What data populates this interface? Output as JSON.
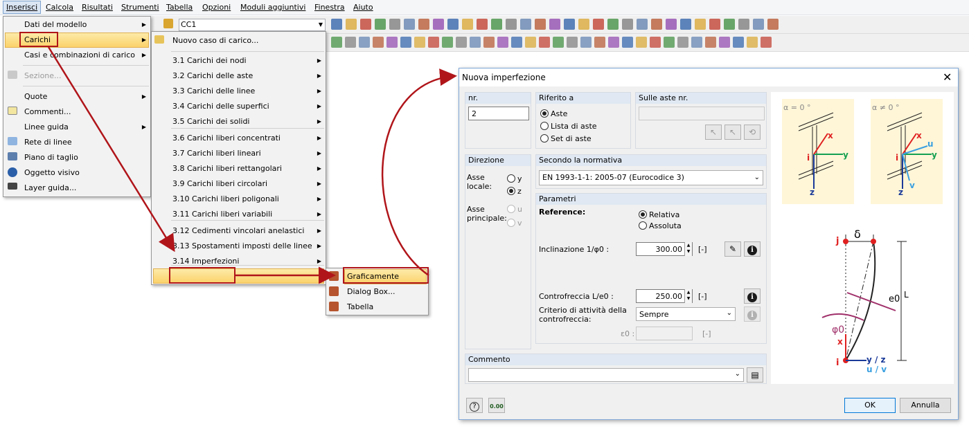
{
  "menubar": {
    "items": [
      "Inserisci",
      "Calcola",
      "Risultati",
      "Strumenti",
      "Tabella",
      "Opzioni",
      "Moduli aggiuntivi",
      "Finestra",
      "Aiuto"
    ]
  },
  "toolbar": {
    "loadcase": "CC1"
  },
  "menu1": {
    "items": [
      "Dati del modello",
      "Carichi",
      "Casi e combinazioni di carico",
      "Sezione...",
      "Quote",
      "Commenti...",
      "Linee guida",
      "Rete di linee",
      "Piano di taglio",
      "Oggetto visivo",
      "Layer guida..."
    ]
  },
  "menu2": {
    "items": [
      "Nuovo caso di carico...",
      "3.1 Carichi dei nodi",
      "3.2 Carichi delle aste",
      "3.3 Carichi delle linee",
      "3.4 Carichi delle superfici",
      "3.5 Carichi dei solidi",
      "3.6 Carichi liberi concentrati",
      "3.7 Carichi liberi lineari",
      "3.8 Carichi liberi rettangolari",
      "3.9 Carichi liberi circolari",
      "3.10 Carichi liberi poligonali",
      "3.11 Carichi liberi variabili",
      "3.12 Cedimenti vincolari anelastici",
      "3.13 Spostamenti imposti delle linee",
      "3.14 Imperfezioni"
    ]
  },
  "menu3": {
    "items": [
      "Graficamente",
      "Dialog Box...",
      "Tabella"
    ]
  },
  "dialog": {
    "title": "Nuova imperfezione",
    "nr_label": "nr.",
    "nr_value": "2",
    "riferimento": {
      "label": "Riferito a",
      "options": [
        "Aste",
        "Lista di aste",
        "Set di aste"
      ]
    },
    "sulle_aste": {
      "label": "Sulle aste nr."
    },
    "direzione": {
      "label": "Direzione",
      "asse_locale": "Asse locale:",
      "asse_principale": "Asse principale:",
      "opts_local": [
        "y",
        "z"
      ],
      "opts_principal": [
        "u",
        "v"
      ]
    },
    "normativa": {
      "label": "Secondo la normativa",
      "value": "EN 1993-1-1: 2005-07  (Eurocodice 3)"
    },
    "parametri": {
      "label": "Parametri",
      "reference": "Reference:",
      "ref_opts": [
        "Relativa",
        "Assoluta"
      ],
      "inclinazione_label": "Inclinazione 1/φ0 :",
      "inclinazione_value": "300.00",
      "unit": "[-]",
      "controfreccia_label": "Controfreccia L/e0 :",
      "controfreccia_value": "250.00",
      "criterio_label": "Criterio di attività della controfreccia:",
      "criterio_value": "Sempre",
      "e0_label": "ε0 :"
    },
    "commento": {
      "label": "Commento"
    },
    "buttons": {
      "ok": "OK",
      "cancel": "Annulla"
    },
    "diagram": {
      "alpha0": "α = 0 °",
      "alphaN": "α ≠ 0 °",
      "delta": "δ",
      "e0": "e0",
      "phi0": "φ0",
      "L": "L",
      "j": "j",
      "i": "i",
      "x": "x",
      "y": "y",
      "z": "z",
      "u": "u",
      "v": "v",
      "yz": "y / z",
      "uv": "u / v"
    }
  },
  "colors": {
    "accent": "#b0151a",
    "highlight": "#fbd26a"
  }
}
